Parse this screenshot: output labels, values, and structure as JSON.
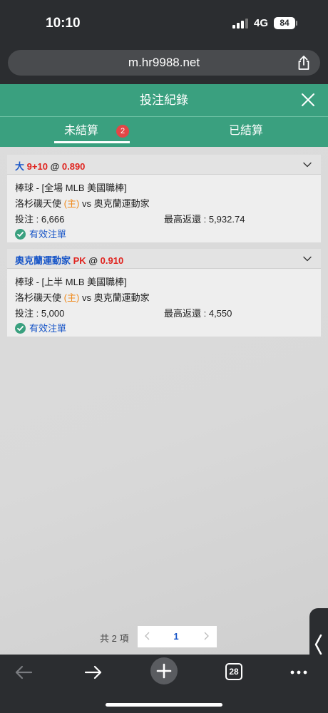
{
  "status": {
    "time": "10:10",
    "network": "4G",
    "battery": "84"
  },
  "browser": {
    "url": "m.hr9988.net",
    "tabs_count": "28"
  },
  "header": {
    "title": "投注紀錄"
  },
  "tabs": {
    "unsettled": "未結算",
    "unsettled_count": "2",
    "settled": "已結算"
  },
  "bets": [
    {
      "selection": "大",
      "line": "9+10",
      "at": "@",
      "odds": "0.890",
      "league": "棒球 - [全場 MLB 美國職棒]",
      "home_team": "洛杉磯天使",
      "home_tag": "(主)",
      "vs": "vs",
      "away_team": "奧克蘭運動家",
      "stake": "投注 : 6,666",
      "max_return": "最高返還 : 5,932.74",
      "status": "有效注單"
    },
    {
      "selection": "奧克蘭運動家",
      "line": "PK",
      "at": "@",
      "odds": "0.910",
      "league": "棒球 - [上半 MLB 美國職棒]",
      "home_team": "洛杉磯天使",
      "home_tag": "(主)",
      "vs": "vs",
      "away_team": "奧克蘭運動家",
      "stake": "投注 : 5,000",
      "max_return": "最高返還 : 4,550",
      "status": "有效注單"
    }
  ],
  "pagination": {
    "total": "共 2 項",
    "current_page": "1"
  },
  "icons": {
    "share": "share-icon",
    "close": "close-icon",
    "chevron": "chevron-down-icon",
    "check": "check-circle-icon",
    "back": "back-arrow-icon",
    "forward": "forward-arrow-icon",
    "new_tab": "plus-icon",
    "more": "more-icon"
  },
  "colors": {
    "accent": "#3aa07f",
    "badge": "#e24646",
    "odds": "#e0241f",
    "selection": "#1a57c8",
    "home_tag": "#f08a1c"
  }
}
